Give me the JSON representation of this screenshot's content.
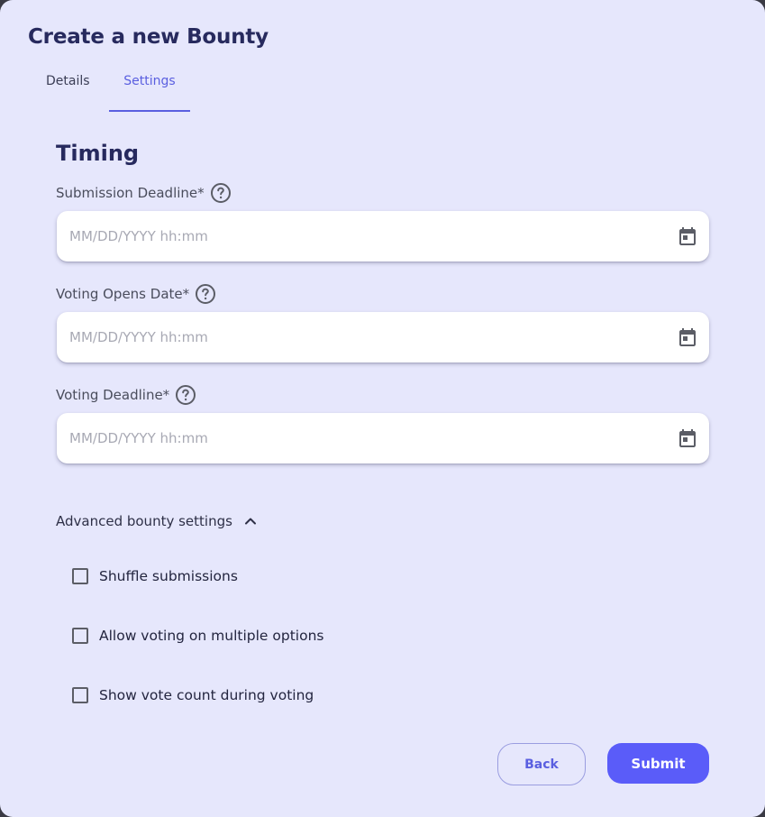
{
  "dialog": {
    "title": "Create a new Bounty"
  },
  "tabs": [
    {
      "label": "Details",
      "active": false
    },
    {
      "label": "Settings",
      "active": true
    }
  ],
  "timing": {
    "section_title": "Timing",
    "fields": [
      {
        "label": "Submission Deadline*",
        "placeholder": "MM/DD/YYYY hh:mm",
        "value": "",
        "help_icon": "question-circle-icon",
        "trailing_icon": "calendar-icon"
      },
      {
        "label": "Voting Opens Date*",
        "placeholder": "MM/DD/YYYY hh:mm",
        "value": "",
        "help_icon": "question-circle-icon",
        "trailing_icon": "calendar-icon"
      },
      {
        "label": "Voting Deadline*",
        "placeholder": "MM/DD/YYYY hh:mm",
        "value": "",
        "help_icon": "question-circle-icon",
        "trailing_icon": "calendar-icon"
      }
    ]
  },
  "advanced": {
    "label": "Advanced bounty settings",
    "expanded": true,
    "icon": "chevron-up-icon",
    "options": [
      {
        "label": "Shuffle submissions",
        "checked": false
      },
      {
        "label": "Allow voting on multiple options",
        "checked": false
      },
      {
        "label": "Show vote count during voting",
        "checked": false
      }
    ]
  },
  "actions": {
    "back_label": "Back",
    "submit_label": "Submit"
  },
  "colors": {
    "background": "#e6e7fc",
    "accent": "#5a5cf9",
    "heading": "#272a5e",
    "tab_active": "#5a5fe0"
  }
}
